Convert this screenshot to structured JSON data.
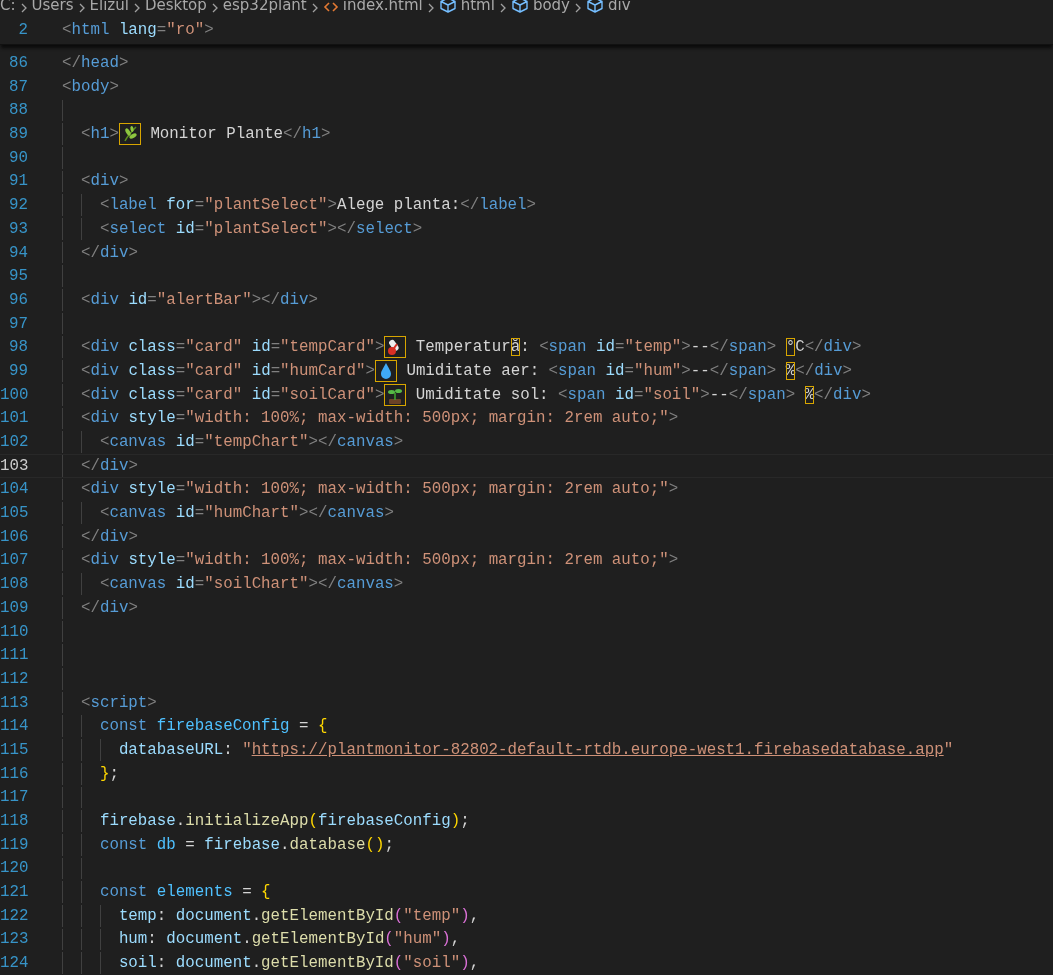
{
  "breadcrumbs": [
    {
      "label": "C:",
      "kind": "folder"
    },
    {
      "label": "Users",
      "kind": "folder"
    },
    {
      "label": "Elizul",
      "kind": "folder"
    },
    {
      "label": "Desktop",
      "kind": "folder"
    },
    {
      "label": "esp32plant",
      "kind": "folder"
    },
    {
      "label": "index.html",
      "kind": "file"
    },
    {
      "label": "html",
      "kind": "element"
    },
    {
      "label": "body",
      "kind": "element"
    },
    {
      "label": "div",
      "kind": "element"
    }
  ],
  "sticky_line": {
    "number": "2",
    "tokens": [
      {
        "kind": "punct",
        "text": "<"
      },
      {
        "kind": "tag",
        "text": "html"
      },
      {
        "kind": "attr",
        "text": " lang"
      },
      {
        "kind": "punct",
        "text": "="
      },
      {
        "kind": "string",
        "text": "\"ro\""
      },
      {
        "kind": "punct",
        "text": ">"
      }
    ]
  },
  "lines": [
    {
      "number": "86",
      "current": false,
      "tokens": [
        {
          "kind": "punct",
          "text": "</"
        },
        {
          "kind": "tag",
          "text": "head"
        },
        {
          "kind": "punct",
          "text": ">"
        }
      ]
    },
    {
      "number": "87",
      "current": false,
      "tokens": [
        {
          "kind": "punct",
          "text": "<"
        },
        {
          "kind": "tag",
          "text": "body"
        },
        {
          "kind": "punct",
          "text": ">"
        }
      ]
    },
    {
      "number": "88",
      "current": false
    },
    {
      "number": "89",
      "current": false,
      "tokens": [
        {
          "kind": "punct",
          "text": "  <"
        },
        {
          "kind": "tag",
          "text": "h1"
        },
        {
          "kind": "punct",
          "text": ">"
        },
        {
          "kind": "leaf"
        },
        {
          "kind": "text",
          "text": " Monitor Plante"
        },
        {
          "kind": "punct",
          "text": "</"
        },
        {
          "kind": "tag",
          "text": "h1"
        },
        {
          "kind": "punct",
          "text": ">"
        }
      ]
    },
    {
      "number": "90",
      "current": false
    },
    {
      "number": "91",
      "current": false,
      "tokens": [
        {
          "kind": "punct",
          "text": "  <"
        },
        {
          "kind": "tag",
          "text": "div"
        },
        {
          "kind": "punct",
          "text": ">"
        }
      ]
    },
    {
      "number": "92",
      "current": false,
      "tokens": [
        {
          "kind": "punct",
          "text": "    <"
        },
        {
          "kind": "tag",
          "text": "label"
        },
        {
          "kind": "attr",
          "text": " for"
        },
        {
          "kind": "punct",
          "text": "="
        },
        {
          "kind": "string",
          "text": "\"plantSelect\""
        },
        {
          "kind": "punct",
          "text": ">"
        },
        {
          "kind": "text",
          "text": "Alege planta:"
        },
        {
          "kind": "punct",
          "text": "</"
        },
        {
          "kind": "tag",
          "text": "label"
        },
        {
          "kind": "punct",
          "text": ">"
        }
      ]
    },
    {
      "number": "93",
      "current": false,
      "tokens": [
        {
          "kind": "punct",
          "text": "    <"
        },
        {
          "kind": "tag",
          "text": "select"
        },
        {
          "kind": "attr",
          "text": " id"
        },
        {
          "kind": "punct",
          "text": "="
        },
        {
          "kind": "string",
          "text": "\"plantSelect\""
        },
        {
          "kind": "punct",
          "text": "></"
        },
        {
          "kind": "tag",
          "text": "select"
        },
        {
          "kind": "punct",
          "text": ">"
        }
      ]
    },
    {
      "number": "94",
      "current": false,
      "tokens": [
        {
          "kind": "punct",
          "text": "  </"
        },
        {
          "kind": "tag",
          "text": "div"
        },
        {
          "kind": "punct",
          "text": ">"
        }
      ]
    },
    {
      "number": "95",
      "current": false
    },
    {
      "number": "96",
      "current": false,
      "tokens": [
        {
          "kind": "punct",
          "text": "  <"
        },
        {
          "kind": "tag",
          "text": "div"
        },
        {
          "kind": "attr",
          "text": " id"
        },
        {
          "kind": "punct",
          "text": "="
        },
        {
          "kind": "string",
          "text": "\"alertBar\""
        },
        {
          "kind": "punct",
          "text": "></"
        },
        {
          "kind": "tag",
          "text": "div"
        },
        {
          "kind": "punct",
          "text": ">"
        }
      ]
    },
    {
      "number": "97",
      "current": false
    },
    {
      "number": "98",
      "current": false,
      "tokens": [
        {
          "kind": "punct",
          "text": "  <"
        },
        {
          "kind": "tag",
          "text": "div"
        },
        {
          "kind": "attr",
          "text": " class"
        },
        {
          "kind": "punct",
          "text": "="
        },
        {
          "kind": "string",
          "text": "\"card\""
        },
        {
          "kind": "attr",
          "text": " id"
        },
        {
          "kind": "punct",
          "text": "="
        },
        {
          "kind": "string",
          "text": "\"tempCard\""
        },
        {
          "kind": "punct",
          "text": ">"
        },
        {
          "kind": "thermometer"
        },
        {
          "kind": "text",
          "text": " Temperatur"
        },
        {
          "kind": "flagged",
          "text": "ă"
        },
        {
          "kind": "text",
          "text": ": "
        },
        {
          "kind": "punct",
          "text": "<"
        },
        {
          "kind": "tag",
          "text": "span"
        },
        {
          "kind": "attr",
          "text": " id"
        },
        {
          "kind": "punct",
          "text": "="
        },
        {
          "kind": "string",
          "text": "\"temp\""
        },
        {
          "kind": "punct",
          "text": ">"
        },
        {
          "kind": "text",
          "text": "--"
        },
        {
          "kind": "punct",
          "text": "</"
        },
        {
          "kind": "tag",
          "text": "span"
        },
        {
          "kind": "punct",
          "text": "> "
        },
        {
          "kind": "flagged",
          "text": "°"
        },
        {
          "kind": "text",
          "text": "C"
        },
        {
          "kind": "punct",
          "text": "</"
        },
        {
          "kind": "tag",
          "text": "div"
        },
        {
          "kind": "punct",
          "text": ">"
        }
      ]
    },
    {
      "number": "99",
      "current": false,
      "tokens": [
        {
          "kind": "punct",
          "text": "  <"
        },
        {
          "kind": "tag",
          "text": "div"
        },
        {
          "kind": "attr",
          "text": " class"
        },
        {
          "kind": "punct",
          "text": "="
        },
        {
          "kind": "string",
          "text": "\"card\""
        },
        {
          "kind": "attr",
          "text": " id"
        },
        {
          "kind": "punct",
          "text": "="
        },
        {
          "kind": "string",
          "text": "\"humCard\""
        },
        {
          "kind": "punct",
          "text": ">"
        },
        {
          "kind": "drop"
        },
        {
          "kind": "text",
          "text": " Umiditate aer: "
        },
        {
          "kind": "punct",
          "text": "<"
        },
        {
          "kind": "tag",
          "text": "span"
        },
        {
          "kind": "attr",
          "text": " id"
        },
        {
          "kind": "punct",
          "text": "="
        },
        {
          "kind": "string",
          "text": "\"hum\""
        },
        {
          "kind": "punct",
          "text": ">"
        },
        {
          "kind": "text",
          "text": "--"
        },
        {
          "kind": "punct",
          "text": "</"
        },
        {
          "kind": "tag",
          "text": "span"
        },
        {
          "kind": "punct",
          "text": "> "
        },
        {
          "kind": "flagged",
          "text": "%"
        },
        {
          "kind": "punct",
          "text": "</"
        },
        {
          "kind": "tag",
          "text": "div"
        },
        {
          "kind": "punct",
          "text": ">"
        }
      ]
    },
    {
      "number": "100",
      "current": false,
      "tokens": [
        {
          "kind": "punct",
          "text": "  <"
        },
        {
          "kind": "tag",
          "text": "div"
        },
        {
          "kind": "attr",
          "text": " class"
        },
        {
          "kind": "punct",
          "text": "="
        },
        {
          "kind": "string",
          "text": "\"card\""
        },
        {
          "kind": "attr",
          "text": " id"
        },
        {
          "kind": "punct",
          "text": "="
        },
        {
          "kind": "string",
          "text": "\"soilCard\""
        },
        {
          "kind": "punct",
          "text": ">"
        },
        {
          "kind": "sprout"
        },
        {
          "kind": "text",
          "text": " Umiditate sol: "
        },
        {
          "kind": "punct",
          "text": "<"
        },
        {
          "kind": "tag",
          "text": "span"
        },
        {
          "kind": "attr",
          "text": " id"
        },
        {
          "kind": "punct",
          "text": "="
        },
        {
          "kind": "string",
          "text": "\"soil\""
        },
        {
          "kind": "punct",
          "text": ">"
        },
        {
          "kind": "text",
          "text": "--"
        },
        {
          "kind": "punct",
          "text": "</"
        },
        {
          "kind": "tag",
          "text": "span"
        },
        {
          "kind": "punct",
          "text": "> "
        },
        {
          "kind": "flagged",
          "text": "%"
        },
        {
          "kind": "punct",
          "text": "</"
        },
        {
          "kind": "tag",
          "text": "div"
        },
        {
          "kind": "punct",
          "text": ">"
        }
      ]
    },
    {
      "number": "101",
      "current": false,
      "tokens": [
        {
          "kind": "punct",
          "text": "  <"
        },
        {
          "kind": "tag",
          "text": "div"
        },
        {
          "kind": "attr",
          "text": " style"
        },
        {
          "kind": "punct",
          "text": "="
        },
        {
          "kind": "string",
          "text": "\"width: 100%; max-width: 500px; margin: 2rem auto;\""
        },
        {
          "kind": "punct",
          "text": ">"
        }
      ]
    },
    {
      "number": "102",
      "current": false,
      "tokens": [
        {
          "kind": "punct",
          "text": "    <"
        },
        {
          "kind": "tag",
          "text": "canvas"
        },
        {
          "kind": "attr",
          "text": " id"
        },
        {
          "kind": "punct",
          "text": "="
        },
        {
          "kind": "string",
          "text": "\"tempChart\""
        },
        {
          "kind": "punct",
          "text": "></"
        },
        {
          "kind": "tag",
          "text": "canvas"
        },
        {
          "kind": "punct",
          "text": ">"
        }
      ]
    },
    {
      "number": "103",
      "current": true,
      "tokens": [
        {
          "kind": "punct",
          "text": "  </"
        },
        {
          "kind": "tag",
          "text": "div"
        },
        {
          "kind": "punct",
          "text": ">"
        }
      ]
    },
    {
      "number": "104",
      "current": false,
      "tokens": [
        {
          "kind": "punct",
          "text": "  <"
        },
        {
          "kind": "tag",
          "text": "div"
        },
        {
          "kind": "attr",
          "text": " style"
        },
        {
          "kind": "punct",
          "text": "="
        },
        {
          "kind": "string",
          "text": "\"width: 100%; max-width: 500px; margin: 2rem auto;\""
        },
        {
          "kind": "punct",
          "text": ">"
        }
      ]
    },
    {
      "number": "105",
      "current": false,
      "tokens": [
        {
          "kind": "punct",
          "text": "    <"
        },
        {
          "kind": "tag",
          "text": "canvas"
        },
        {
          "kind": "attr",
          "text": " id"
        },
        {
          "kind": "punct",
          "text": "="
        },
        {
          "kind": "string",
          "text": "\"humChart\""
        },
        {
          "kind": "punct",
          "text": "></"
        },
        {
          "kind": "tag",
          "text": "canvas"
        },
        {
          "kind": "punct",
          "text": ">"
        }
      ]
    },
    {
      "number": "106",
      "current": false,
      "tokens": [
        {
          "kind": "punct",
          "text": "  </"
        },
        {
          "kind": "tag",
          "text": "div"
        },
        {
          "kind": "punct",
          "text": ">"
        }
      ]
    },
    {
      "number": "107",
      "current": false,
      "tokens": [
        {
          "kind": "punct",
          "text": "  <"
        },
        {
          "kind": "tag",
          "text": "div"
        },
        {
          "kind": "attr",
          "text": " style"
        },
        {
          "kind": "punct",
          "text": "="
        },
        {
          "kind": "string",
          "text": "\"width: 100%; max-width: 500px; margin: 2rem auto;\""
        },
        {
          "kind": "punct",
          "text": ">"
        }
      ]
    },
    {
      "number": "108",
      "current": false,
      "tokens": [
        {
          "kind": "punct",
          "text": "    <"
        },
        {
          "kind": "tag",
          "text": "canvas"
        },
        {
          "kind": "attr",
          "text": " id"
        },
        {
          "kind": "punct",
          "text": "="
        },
        {
          "kind": "string",
          "text": "\"soilChart\""
        },
        {
          "kind": "punct",
          "text": "></"
        },
        {
          "kind": "tag",
          "text": "canvas"
        },
        {
          "kind": "punct",
          "text": ">"
        }
      ]
    },
    {
      "number": "109",
      "current": false,
      "tokens": [
        {
          "kind": "punct",
          "text": "  </"
        },
        {
          "kind": "tag",
          "text": "div"
        },
        {
          "kind": "punct",
          "text": ">"
        }
      ]
    },
    {
      "number": "110",
      "current": false
    },
    {
      "number": "111",
      "current": false
    },
    {
      "number": "112",
      "current": false
    },
    {
      "number": "113",
      "current": false,
      "tokens": [
        {
          "kind": "punct",
          "text": "  <"
        },
        {
          "kind": "tag",
          "text": "script"
        },
        {
          "kind": "punct",
          "text": ">"
        }
      ]
    },
    {
      "number": "114",
      "current": false,
      "tokens": [
        {
          "kind": "keyword",
          "text": "    const"
        },
        {
          "kind": "constant",
          "text": " firebaseConfig"
        },
        {
          "kind": "text",
          "text": " = "
        },
        {
          "kind": "brace1",
          "text": "{"
        }
      ]
    },
    {
      "number": "115",
      "current": false,
      "tokens": [
        {
          "kind": "prop",
          "text": "      databaseURL"
        },
        {
          "kind": "text",
          "text": ": "
        },
        {
          "kind": "string",
          "text": "\""
        },
        {
          "kind": "url",
          "text": "https://plantmonitor-82802-default-rtdb.europe-west1.firebasedatabase.app"
        },
        {
          "kind": "string",
          "text": "\""
        }
      ]
    },
    {
      "number": "116",
      "current": false,
      "tokens": [
        {
          "kind": "brace1",
          "text": "    }"
        },
        {
          "kind": "text",
          "text": ";"
        }
      ]
    },
    {
      "number": "117",
      "current": false
    },
    {
      "number": "118",
      "current": false,
      "tokens": [
        {
          "kind": "prop",
          "text": "    firebase"
        },
        {
          "kind": "text",
          "text": "."
        },
        {
          "kind": "func",
          "text": "initializeApp"
        },
        {
          "kind": "brace1",
          "text": "("
        },
        {
          "kind": "prop",
          "text": "firebaseConfig"
        },
        {
          "kind": "brace1",
          "text": ")"
        },
        {
          "kind": "text",
          "text": ";"
        }
      ]
    },
    {
      "number": "119",
      "current": false,
      "tokens": [
        {
          "kind": "keyword",
          "text": "    const"
        },
        {
          "kind": "constant",
          "text": " db"
        },
        {
          "kind": "text",
          "text": " = "
        },
        {
          "kind": "prop",
          "text": "firebase"
        },
        {
          "kind": "text",
          "text": "."
        },
        {
          "kind": "func",
          "text": "database"
        },
        {
          "kind": "brace1",
          "text": "()"
        },
        {
          "kind": "text",
          "text": ";"
        }
      ]
    },
    {
      "number": "120",
      "current": false
    },
    {
      "number": "121",
      "current": false,
      "tokens": [
        {
          "kind": "keyword",
          "text": "    const"
        },
        {
          "kind": "constant",
          "text": " elements"
        },
        {
          "kind": "text",
          "text": " = "
        },
        {
          "kind": "brace1",
          "text": "{"
        }
      ]
    },
    {
      "number": "122",
      "current": false,
      "tokens": [
        {
          "kind": "prop",
          "text": "      temp"
        },
        {
          "kind": "text",
          "text": ": "
        },
        {
          "kind": "prop",
          "text": "document"
        },
        {
          "kind": "text",
          "text": "."
        },
        {
          "kind": "func",
          "text": "getElementById"
        },
        {
          "kind": "brace2",
          "text": "("
        },
        {
          "kind": "string",
          "text": "\"temp\""
        },
        {
          "kind": "brace2",
          "text": ")"
        },
        {
          "kind": "text",
          "text": ","
        }
      ]
    },
    {
      "number": "123",
      "current": false,
      "tokens": [
        {
          "kind": "prop",
          "text": "      hum"
        },
        {
          "kind": "text",
          "text": ": "
        },
        {
          "kind": "prop",
          "text": "document"
        },
        {
          "kind": "text",
          "text": "."
        },
        {
          "kind": "func",
          "text": "getElementById"
        },
        {
          "kind": "brace2",
          "text": "("
        },
        {
          "kind": "string",
          "text": "\"hum\""
        },
        {
          "kind": "brace2",
          "text": ")"
        },
        {
          "kind": "text",
          "text": ","
        }
      ]
    },
    {
      "number": "124",
      "current": false,
      "tokens": [
        {
          "kind": "prop",
          "text": "      soil"
        },
        {
          "kind": "text",
          "text": ": "
        },
        {
          "kind": "prop",
          "text": "document"
        },
        {
          "kind": "text",
          "text": "."
        },
        {
          "kind": "func",
          "text": "getElementById"
        },
        {
          "kind": "brace2",
          "text": "("
        },
        {
          "kind": "string",
          "text": "\"soil\""
        },
        {
          "kind": "brace2",
          "text": ")"
        },
        {
          "kind": "text",
          "text": ","
        }
      ]
    }
  ]
}
